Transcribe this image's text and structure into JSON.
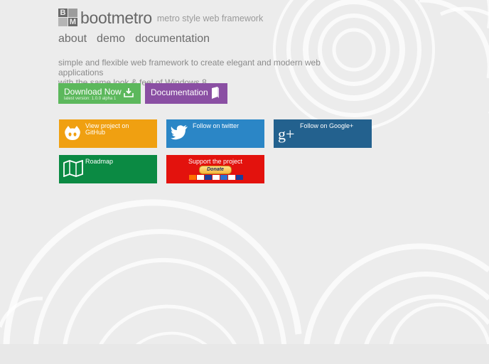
{
  "brand": {
    "logo_letters": [
      "B",
      "M"
    ],
    "name": "bootmetro",
    "tagline": "metro style web framework"
  },
  "nav": [
    {
      "label": "about"
    },
    {
      "label": "demo"
    },
    {
      "label": "documentation"
    }
  ],
  "intro_line1": "simple and flexible web framework to create elegant and modern web applications",
  "intro_line2": "with the same look & feel of Windows 8",
  "download": {
    "label": "Download Now",
    "version": "latest version: 1.0.0 alpha 1",
    "color": "#5cb85c"
  },
  "docs": {
    "label": "Documentation",
    "color": "#8a4fa3"
  },
  "tiles": {
    "github": {
      "line1": "View project on",
      "line2": "GitHub",
      "color": "#f0a011",
      "icon": "github-octocat-icon"
    },
    "twitter": {
      "label": "Follow on twitter",
      "color": "#2b86c6",
      "icon": "twitter-bird-icon"
    },
    "google": {
      "label": "Follow on Google+",
      "color": "#23618e",
      "icon": "google-plus-icon"
    },
    "roadmap": {
      "label": "Roadmap",
      "color": "#0b8a43",
      "icon": "map-icon"
    },
    "support": {
      "label": "Support the project",
      "donate": "Donate",
      "color": "#e3120d"
    }
  },
  "colors": {
    "background": "#ececec",
    "text": "#555555"
  }
}
